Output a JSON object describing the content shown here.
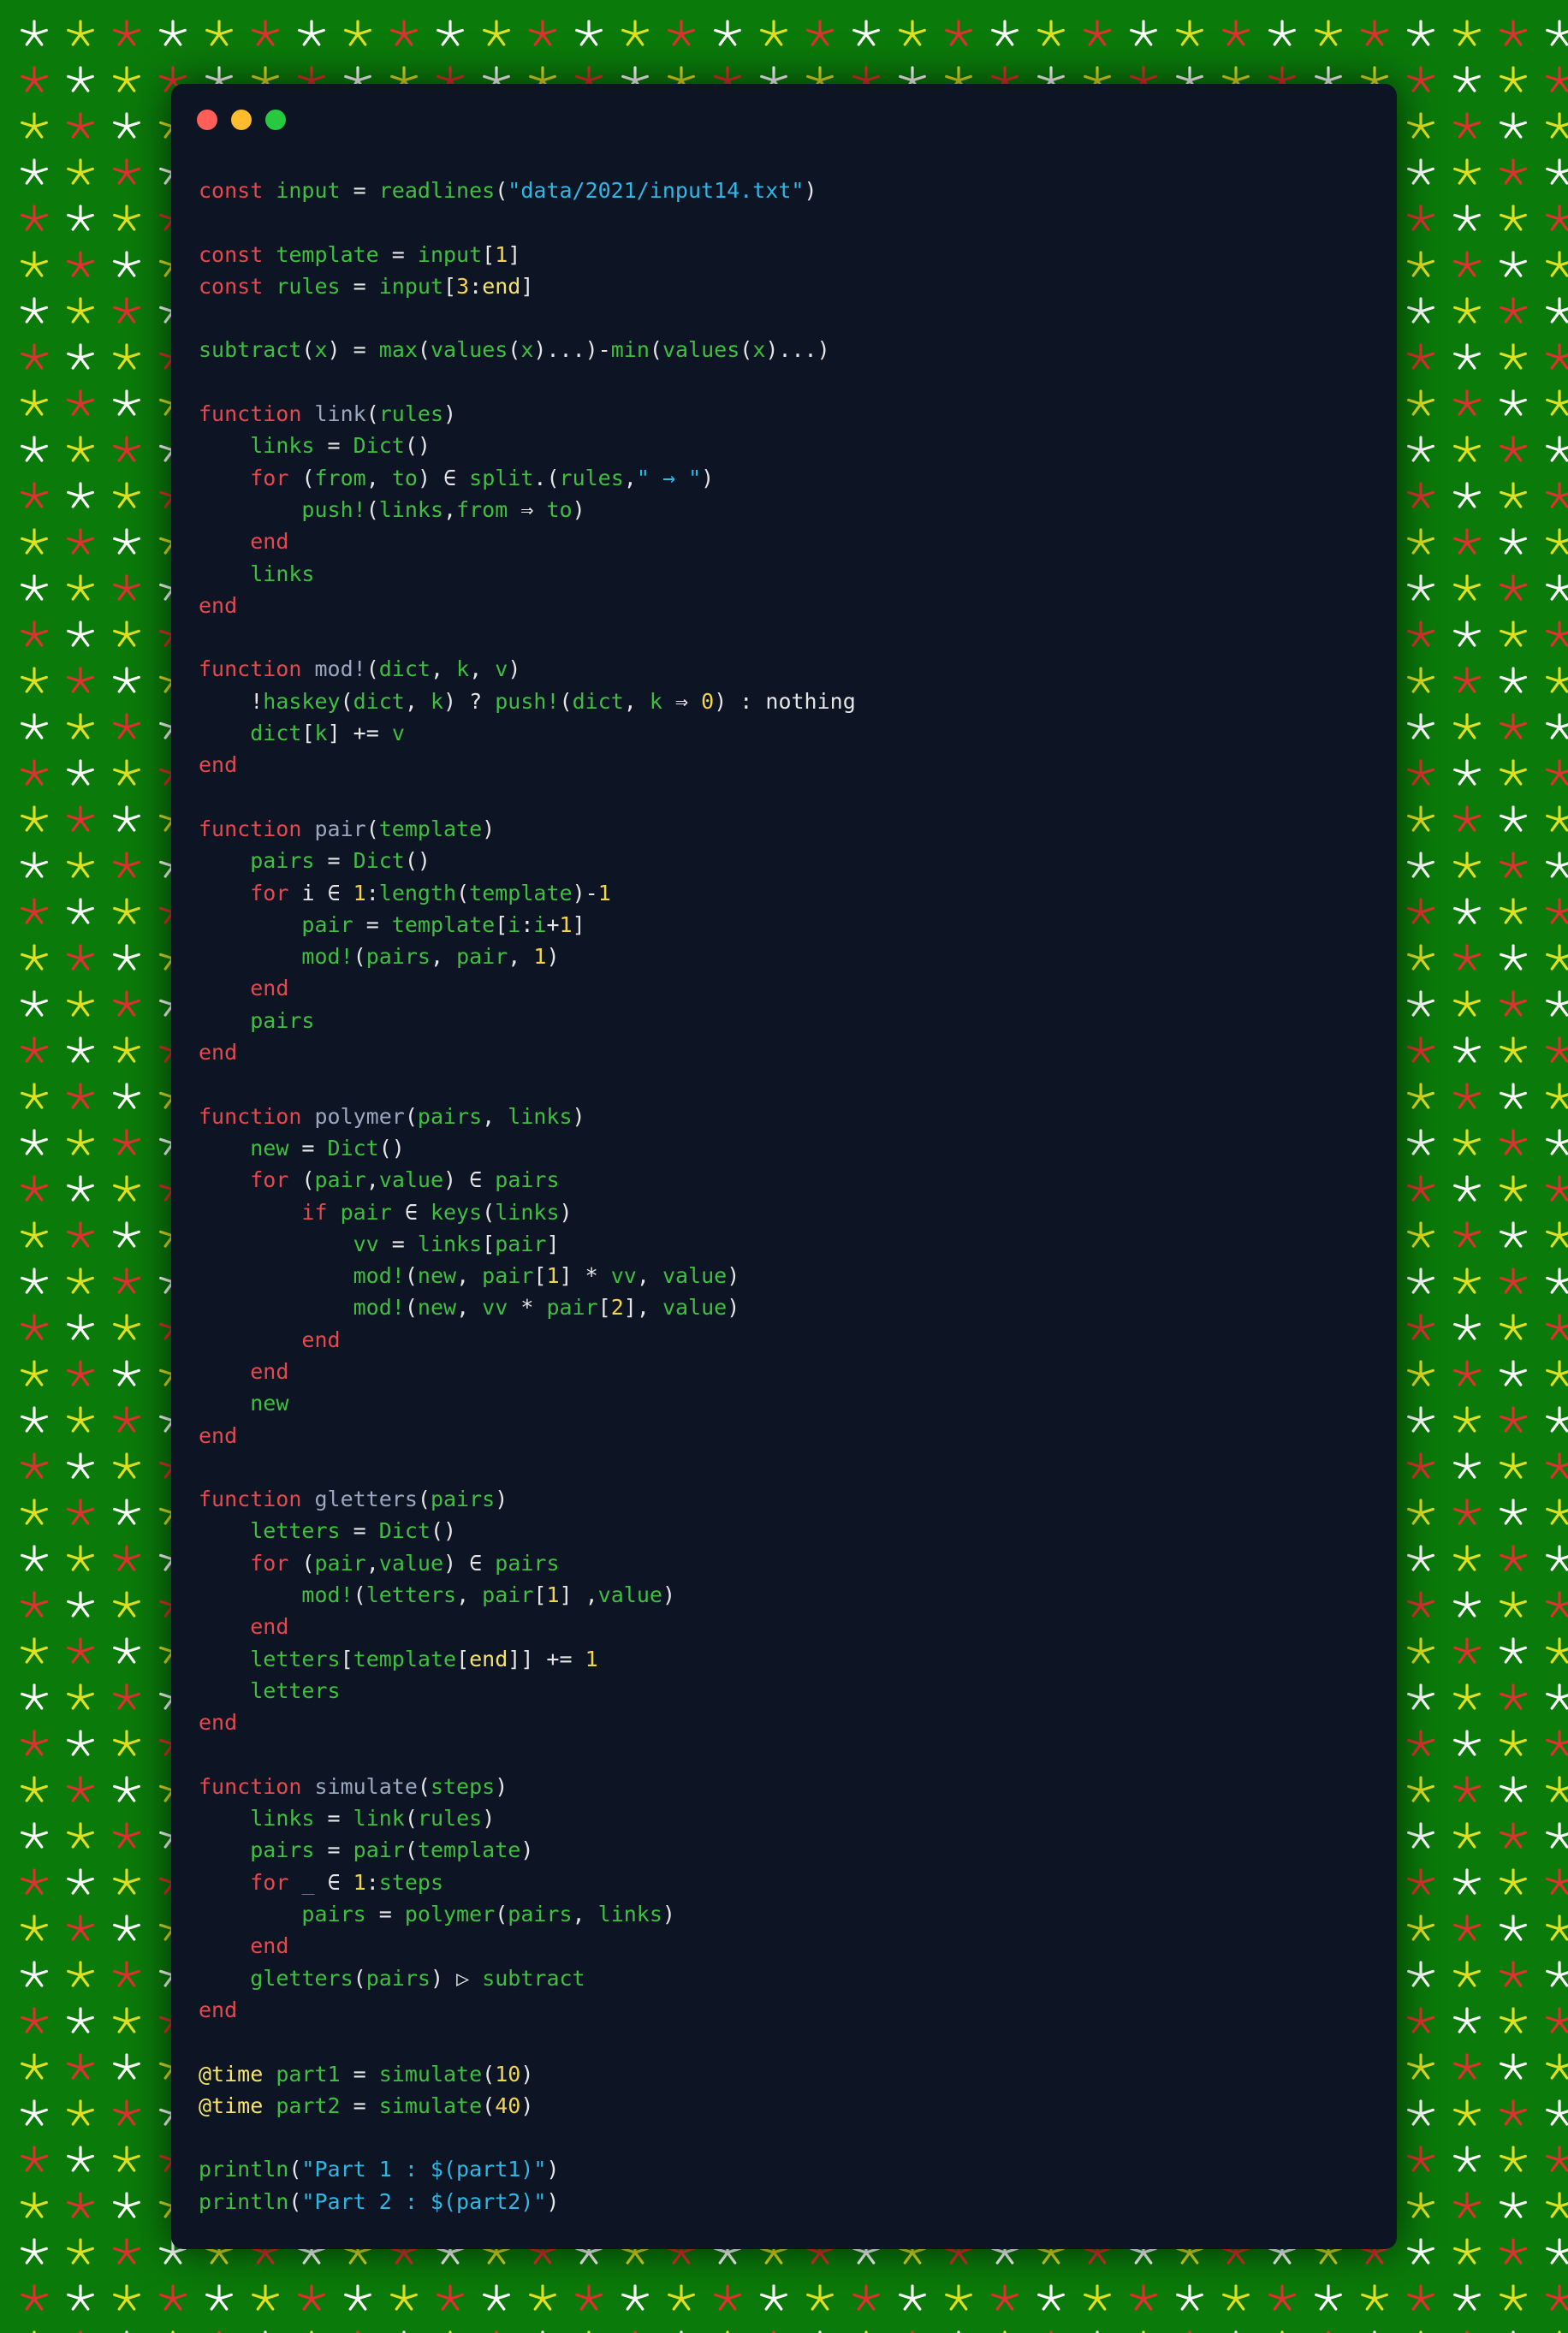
{
  "window": {
    "controls": {
      "close_color": "#ff5f57",
      "minimize_color": "#febc2e",
      "maximize_color": "#28c840"
    }
  },
  "colors": {
    "background": "#0a7a0a",
    "editor": "#0d1424",
    "keyword": "#e5484d",
    "identifier": "#3fbf3f",
    "function_name": "#9aa7bf",
    "string": "#2eb8e6",
    "number": "#f5d547",
    "macro": "#f5e36b",
    "star_colors": [
      "#ffffff",
      "#e0e020",
      "#e03030"
    ]
  },
  "code_lines": [
    [
      [
        "kw",
        "const "
      ],
      [
        "id",
        "input"
      ],
      [
        "pl",
        " = "
      ],
      [
        "id",
        "readlines"
      ],
      [
        "pl",
        "("
      ],
      [
        "str",
        "\"data/2021/input14.txt\""
      ],
      [
        "pl",
        ")"
      ]
    ],
    [],
    [
      [
        "kw",
        "const "
      ],
      [
        "id",
        "template"
      ],
      [
        "pl",
        " = "
      ],
      [
        "id",
        "input"
      ],
      [
        "pl",
        "["
      ],
      [
        "num",
        "1"
      ],
      [
        "pl",
        "]"
      ]
    ],
    [
      [
        "kw",
        "const "
      ],
      [
        "id",
        "rules"
      ],
      [
        "pl",
        " = "
      ],
      [
        "id",
        "input"
      ],
      [
        "pl",
        "["
      ],
      [
        "num",
        "3"
      ],
      [
        "pl",
        ":"
      ],
      [
        "mac",
        "end"
      ],
      [
        "pl",
        "]"
      ]
    ],
    [],
    [
      [
        "id",
        "subtract"
      ],
      [
        "pl",
        "("
      ],
      [
        "id",
        "x"
      ],
      [
        "pl",
        ") = "
      ],
      [
        "id",
        "max"
      ],
      [
        "pl",
        "("
      ],
      [
        "id",
        "values"
      ],
      [
        "pl",
        "("
      ],
      [
        "id",
        "x"
      ],
      [
        "pl",
        ")...)-"
      ],
      [
        "id",
        "min"
      ],
      [
        "pl",
        "("
      ],
      [
        "id",
        "values"
      ],
      [
        "pl",
        "("
      ],
      [
        "id",
        "x"
      ],
      [
        "pl",
        ")...)"
      ]
    ],
    [],
    [
      [
        "kw",
        "function "
      ],
      [
        "fn",
        "link"
      ],
      [
        "pl",
        "("
      ],
      [
        "id",
        "rules"
      ],
      [
        "pl",
        ")"
      ]
    ],
    [
      [
        "pl",
        "    "
      ],
      [
        "id",
        "links"
      ],
      [
        "pl",
        " = "
      ],
      [
        "id",
        "Dict"
      ],
      [
        "pl",
        "()"
      ]
    ],
    [
      [
        "pl",
        "    "
      ],
      [
        "kw",
        "for "
      ],
      [
        "pl",
        "("
      ],
      [
        "id",
        "from"
      ],
      [
        "pl",
        ", "
      ],
      [
        "id",
        "to"
      ],
      [
        "pl",
        ") ∈ "
      ],
      [
        "id",
        "split"
      ],
      [
        "pl",
        ".("
      ],
      [
        "id",
        "rules"
      ],
      [
        "pl",
        ","
      ],
      [
        "str",
        "\" → \""
      ],
      [
        "pl",
        ")"
      ]
    ],
    [
      [
        "pl",
        "        "
      ],
      [
        "id",
        "push!"
      ],
      [
        "pl",
        "("
      ],
      [
        "id",
        "links"
      ],
      [
        "pl",
        ","
      ],
      [
        "id",
        "from"
      ],
      [
        "pl",
        " ⇒ "
      ],
      [
        "id",
        "to"
      ],
      [
        "pl",
        ")"
      ]
    ],
    [
      [
        "pl",
        "    "
      ],
      [
        "kw",
        "end"
      ]
    ],
    [
      [
        "pl",
        "    "
      ],
      [
        "id",
        "links"
      ]
    ],
    [
      [
        "kw",
        "end"
      ]
    ],
    [],
    [
      [
        "kw",
        "function "
      ],
      [
        "fn",
        "mod!"
      ],
      [
        "pl",
        "("
      ],
      [
        "id",
        "dict"
      ],
      [
        "pl",
        ", "
      ],
      [
        "id",
        "k"
      ],
      [
        "pl",
        ", "
      ],
      [
        "id",
        "v"
      ],
      [
        "pl",
        ")"
      ]
    ],
    [
      [
        "pl",
        "    !"
      ],
      [
        "id",
        "haskey"
      ],
      [
        "pl",
        "("
      ],
      [
        "id",
        "dict"
      ],
      [
        "pl",
        ", "
      ],
      [
        "id",
        "k"
      ],
      [
        "pl",
        ") ? "
      ],
      [
        "id",
        "push!"
      ],
      [
        "pl",
        "("
      ],
      [
        "id",
        "dict"
      ],
      [
        "pl",
        ", "
      ],
      [
        "id",
        "k"
      ],
      [
        "pl",
        " ⇒ "
      ],
      [
        "num",
        "0"
      ],
      [
        "pl",
        ") : nothing"
      ]
    ],
    [
      [
        "pl",
        "    "
      ],
      [
        "id",
        "dict"
      ],
      [
        "pl",
        "["
      ],
      [
        "id",
        "k"
      ],
      [
        "pl",
        "] += "
      ],
      [
        "id",
        "v"
      ]
    ],
    [
      [
        "kw",
        "end"
      ]
    ],
    [],
    [
      [
        "kw",
        "function "
      ],
      [
        "fn",
        "pair"
      ],
      [
        "pl",
        "("
      ],
      [
        "id",
        "template"
      ],
      [
        "pl",
        ")"
      ]
    ],
    [
      [
        "pl",
        "    "
      ],
      [
        "id",
        "pairs"
      ],
      [
        "pl",
        " = "
      ],
      [
        "id",
        "Dict"
      ],
      [
        "pl",
        "()"
      ]
    ],
    [
      [
        "pl",
        "    "
      ],
      [
        "kw",
        "for "
      ],
      [
        "pl",
        "i ∈ "
      ],
      [
        "num",
        "1"
      ],
      [
        "pl",
        ":"
      ],
      [
        "id",
        "length"
      ],
      [
        "pl",
        "("
      ],
      [
        "id",
        "template"
      ],
      [
        "pl",
        ")-"
      ],
      [
        "num",
        "1"
      ]
    ],
    [
      [
        "pl",
        "        "
      ],
      [
        "id",
        "pair"
      ],
      [
        "pl",
        " = "
      ],
      [
        "id",
        "template"
      ],
      [
        "pl",
        "["
      ],
      [
        "id",
        "i"
      ],
      [
        "pl",
        ":"
      ],
      [
        "id",
        "i"
      ],
      [
        "pl",
        "+"
      ],
      [
        "num",
        "1"
      ],
      [
        "pl",
        "]"
      ]
    ],
    [
      [
        "pl",
        "        "
      ],
      [
        "id",
        "mod!"
      ],
      [
        "pl",
        "("
      ],
      [
        "id",
        "pairs"
      ],
      [
        "pl",
        ", "
      ],
      [
        "id",
        "pair"
      ],
      [
        "pl",
        ", "
      ],
      [
        "num",
        "1"
      ],
      [
        "pl",
        ")"
      ]
    ],
    [
      [
        "pl",
        "    "
      ],
      [
        "kw",
        "end"
      ]
    ],
    [
      [
        "pl",
        "    "
      ],
      [
        "id",
        "pairs"
      ]
    ],
    [
      [
        "kw",
        "end"
      ]
    ],
    [],
    [
      [
        "kw",
        "function "
      ],
      [
        "fn",
        "polymer"
      ],
      [
        "pl",
        "("
      ],
      [
        "id",
        "pairs"
      ],
      [
        "pl",
        ", "
      ],
      [
        "id",
        "links"
      ],
      [
        "pl",
        ")"
      ]
    ],
    [
      [
        "pl",
        "    "
      ],
      [
        "id",
        "new"
      ],
      [
        "pl",
        " = "
      ],
      [
        "id",
        "Dict"
      ],
      [
        "pl",
        "()"
      ]
    ],
    [
      [
        "pl",
        "    "
      ],
      [
        "kw",
        "for "
      ],
      [
        "pl",
        "("
      ],
      [
        "id",
        "pair"
      ],
      [
        "pl",
        ","
      ],
      [
        "id",
        "value"
      ],
      [
        "pl",
        ") ∈ "
      ],
      [
        "id",
        "pairs"
      ]
    ],
    [
      [
        "pl",
        "        "
      ],
      [
        "kw",
        "if "
      ],
      [
        "id",
        "pair"
      ],
      [
        "pl",
        " ∈ "
      ],
      [
        "id",
        "keys"
      ],
      [
        "pl",
        "("
      ],
      [
        "id",
        "links"
      ],
      [
        "pl",
        ")"
      ]
    ],
    [
      [
        "pl",
        "            "
      ],
      [
        "id",
        "vv"
      ],
      [
        "pl",
        " = "
      ],
      [
        "id",
        "links"
      ],
      [
        "pl",
        "["
      ],
      [
        "id",
        "pair"
      ],
      [
        "pl",
        "]"
      ]
    ],
    [
      [
        "pl",
        "            "
      ],
      [
        "id",
        "mod!"
      ],
      [
        "pl",
        "("
      ],
      [
        "id",
        "new"
      ],
      [
        "pl",
        ", "
      ],
      [
        "id",
        "pair"
      ],
      [
        "pl",
        "["
      ],
      [
        "num",
        "1"
      ],
      [
        "pl",
        "] * "
      ],
      [
        "id",
        "vv"
      ],
      [
        "pl",
        ", "
      ],
      [
        "id",
        "value"
      ],
      [
        "pl",
        ")"
      ]
    ],
    [
      [
        "pl",
        "            "
      ],
      [
        "id",
        "mod!"
      ],
      [
        "pl",
        "("
      ],
      [
        "id",
        "new"
      ],
      [
        "pl",
        ", "
      ],
      [
        "id",
        "vv"
      ],
      [
        "pl",
        " * "
      ],
      [
        "id",
        "pair"
      ],
      [
        "pl",
        "["
      ],
      [
        "num",
        "2"
      ],
      [
        "pl",
        "], "
      ],
      [
        "id",
        "value"
      ],
      [
        "pl",
        ")"
      ]
    ],
    [
      [
        "pl",
        "        "
      ],
      [
        "kw",
        "end"
      ]
    ],
    [
      [
        "pl",
        "    "
      ],
      [
        "kw",
        "end"
      ]
    ],
    [
      [
        "pl",
        "    "
      ],
      [
        "id",
        "new"
      ]
    ],
    [
      [
        "kw",
        "end"
      ]
    ],
    [],
    [
      [
        "kw",
        "function "
      ],
      [
        "fn",
        "gletters"
      ],
      [
        "pl",
        "("
      ],
      [
        "id",
        "pairs"
      ],
      [
        "pl",
        ")"
      ]
    ],
    [
      [
        "pl",
        "    "
      ],
      [
        "id",
        "letters"
      ],
      [
        "pl",
        " = "
      ],
      [
        "id",
        "Dict"
      ],
      [
        "pl",
        "()"
      ]
    ],
    [
      [
        "pl",
        "    "
      ],
      [
        "kw",
        "for "
      ],
      [
        "pl",
        "("
      ],
      [
        "id",
        "pair"
      ],
      [
        "pl",
        ","
      ],
      [
        "id",
        "value"
      ],
      [
        "pl",
        ") ∈ "
      ],
      [
        "id",
        "pairs"
      ]
    ],
    [
      [
        "pl",
        "        "
      ],
      [
        "id",
        "mod!"
      ],
      [
        "pl",
        "("
      ],
      [
        "id",
        "letters"
      ],
      [
        "pl",
        ", "
      ],
      [
        "id",
        "pair"
      ],
      [
        "pl",
        "["
      ],
      [
        "num",
        "1"
      ],
      [
        "pl",
        "] ,"
      ],
      [
        "id",
        "value"
      ],
      [
        "pl",
        ")"
      ]
    ],
    [
      [
        "pl",
        "    "
      ],
      [
        "kw",
        "end"
      ]
    ],
    [
      [
        "pl",
        "    "
      ],
      [
        "id",
        "letters"
      ],
      [
        "pl",
        "["
      ],
      [
        "id",
        "template"
      ],
      [
        "pl",
        "["
      ],
      [
        "mac",
        "end"
      ],
      [
        "pl",
        "]] += "
      ],
      [
        "num",
        "1"
      ]
    ],
    [
      [
        "pl",
        "    "
      ],
      [
        "id",
        "letters"
      ]
    ],
    [
      [
        "kw",
        "end"
      ]
    ],
    [],
    [
      [
        "kw",
        "function "
      ],
      [
        "fn",
        "simulate"
      ],
      [
        "pl",
        "("
      ],
      [
        "id",
        "steps"
      ],
      [
        "pl",
        ")"
      ]
    ],
    [
      [
        "pl",
        "    "
      ],
      [
        "id",
        "links"
      ],
      [
        "pl",
        " = "
      ],
      [
        "id",
        "link"
      ],
      [
        "pl",
        "("
      ],
      [
        "id",
        "rules"
      ],
      [
        "pl",
        ")"
      ]
    ],
    [
      [
        "pl",
        "    "
      ],
      [
        "id",
        "pairs"
      ],
      [
        "pl",
        " = "
      ],
      [
        "id",
        "pair"
      ],
      [
        "pl",
        "("
      ],
      [
        "id",
        "template"
      ],
      [
        "pl",
        ")"
      ]
    ],
    [
      [
        "pl",
        "    "
      ],
      [
        "kw",
        "for "
      ],
      [
        "kw",
        "_"
      ],
      [
        "pl",
        " ∈ "
      ],
      [
        "num",
        "1"
      ],
      [
        "pl",
        ":"
      ],
      [
        "id",
        "steps"
      ]
    ],
    [
      [
        "pl",
        "        "
      ],
      [
        "id",
        "pairs"
      ],
      [
        "pl",
        " = "
      ],
      [
        "id",
        "polymer"
      ],
      [
        "pl",
        "("
      ],
      [
        "id",
        "pairs"
      ],
      [
        "pl",
        ", "
      ],
      [
        "id",
        "links"
      ],
      [
        "pl",
        ")"
      ]
    ],
    [
      [
        "pl",
        "    "
      ],
      [
        "kw",
        "end"
      ]
    ],
    [
      [
        "pl",
        "    "
      ],
      [
        "id",
        "gletters"
      ],
      [
        "pl",
        "("
      ],
      [
        "id",
        "pairs"
      ],
      [
        "pl",
        ") ▷ "
      ],
      [
        "id",
        "subtract"
      ]
    ],
    [
      [
        "kw",
        "end"
      ]
    ],
    [],
    [
      [
        "mac",
        "@time "
      ],
      [
        "id",
        "part1"
      ],
      [
        "pl",
        " = "
      ],
      [
        "id",
        "simulate"
      ],
      [
        "pl",
        "("
      ],
      [
        "num",
        "10"
      ],
      [
        "pl",
        ")"
      ]
    ],
    [
      [
        "mac",
        "@time "
      ],
      [
        "id",
        "part2"
      ],
      [
        "pl",
        " = "
      ],
      [
        "id",
        "simulate"
      ],
      [
        "pl",
        "("
      ],
      [
        "num",
        "40"
      ],
      [
        "pl",
        ")"
      ]
    ],
    [],
    [
      [
        "id",
        "println"
      ],
      [
        "pl",
        "("
      ],
      [
        "str",
        "\"Part 1 : $(part1)\""
      ],
      [
        "pl",
        ")"
      ]
    ],
    [
      [
        "id",
        "println"
      ],
      [
        "pl",
        "("
      ],
      [
        "str",
        "\"Part 2 : $(part2)\""
      ],
      [
        "pl",
        ")"
      ]
    ]
  ]
}
